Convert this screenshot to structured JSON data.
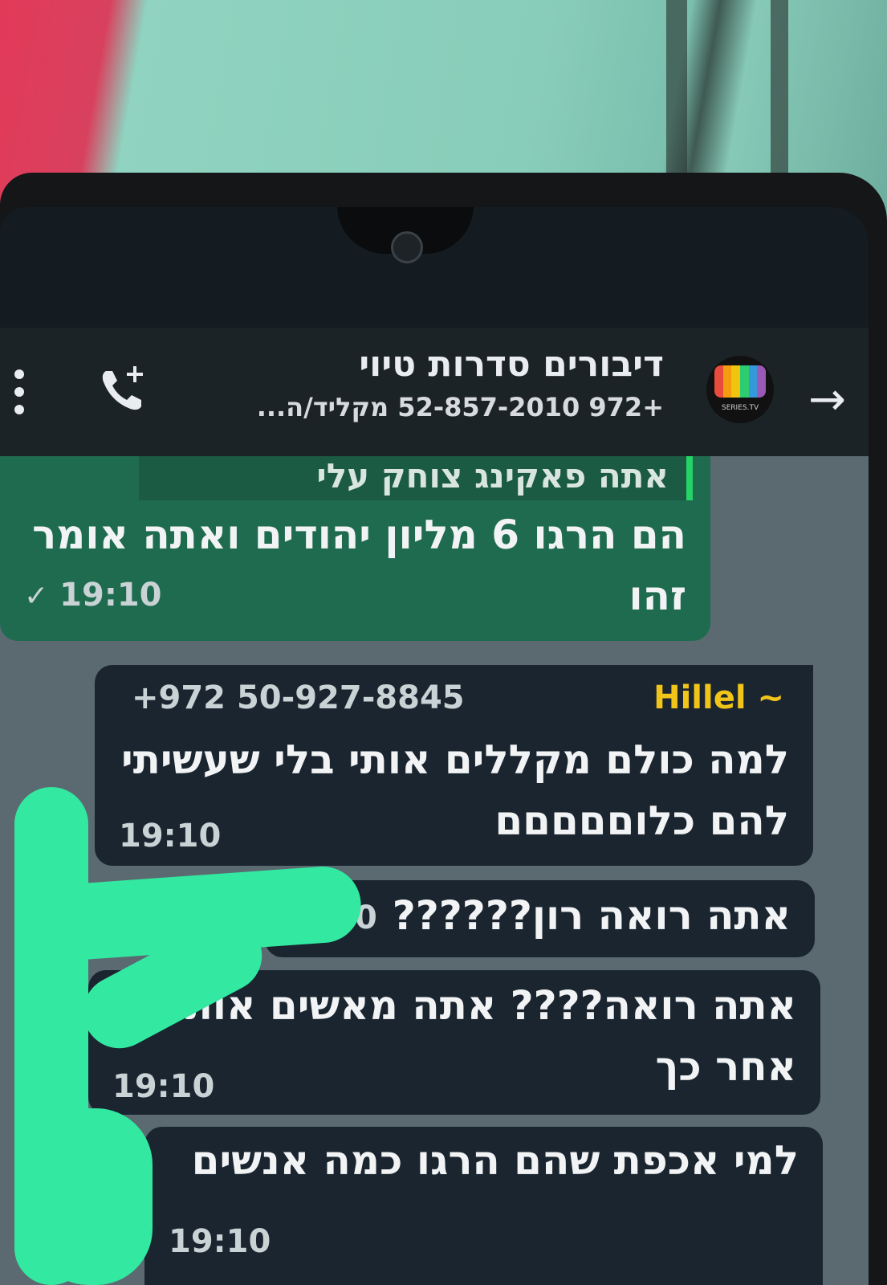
{
  "header": {
    "title": "דיבורים סדרות טיוי",
    "subtitle": "+972 52-857-2010 מקליד/ה...",
    "avatar_brand": "SERIES.TV",
    "back_icon": "arrow-right-icon",
    "call_icon": "add-call-icon",
    "menu_icon": "more-vertical-icon",
    "avatar_colors": [
      "#e74c3c",
      "#f39c12",
      "#f1c40f",
      "#2ecc71",
      "#3498db",
      "#9b59b6"
    ]
  },
  "messages": [
    {
      "type": "outgoing",
      "quote": "אתה פאקינג צוחק עלי",
      "text": "הם הרגו 6 מליון יהודים ואתה אומר\nזהו",
      "time": "19:10",
      "status": "✓"
    },
    {
      "type": "incoming",
      "sender": "~ Hillel",
      "sender_phone": "+972 50-927-8845",
      "text": "למה כולם מקללים אותי בלי שעשיתי\nלהם כלוםםםםם",
      "time": "19:10"
    },
    {
      "type": "incoming",
      "text": "אתה רואה רון??????",
      "time_partial": "0"
    },
    {
      "type": "incoming",
      "text": "אתה רואה???? אתה מאשים אותי\nאחר כך",
      "time": "19:10"
    },
    {
      "type": "incoming",
      "text": "למי אכפת שהם הרגו כמה אנשים",
      "time": "19:10"
    }
  ],
  "colors": {
    "outgoing_bubble": "#1f6b4f",
    "incoming_bubble": "#1a2530",
    "sender_name": "#f0c419",
    "scribble": "#33e8a0"
  }
}
